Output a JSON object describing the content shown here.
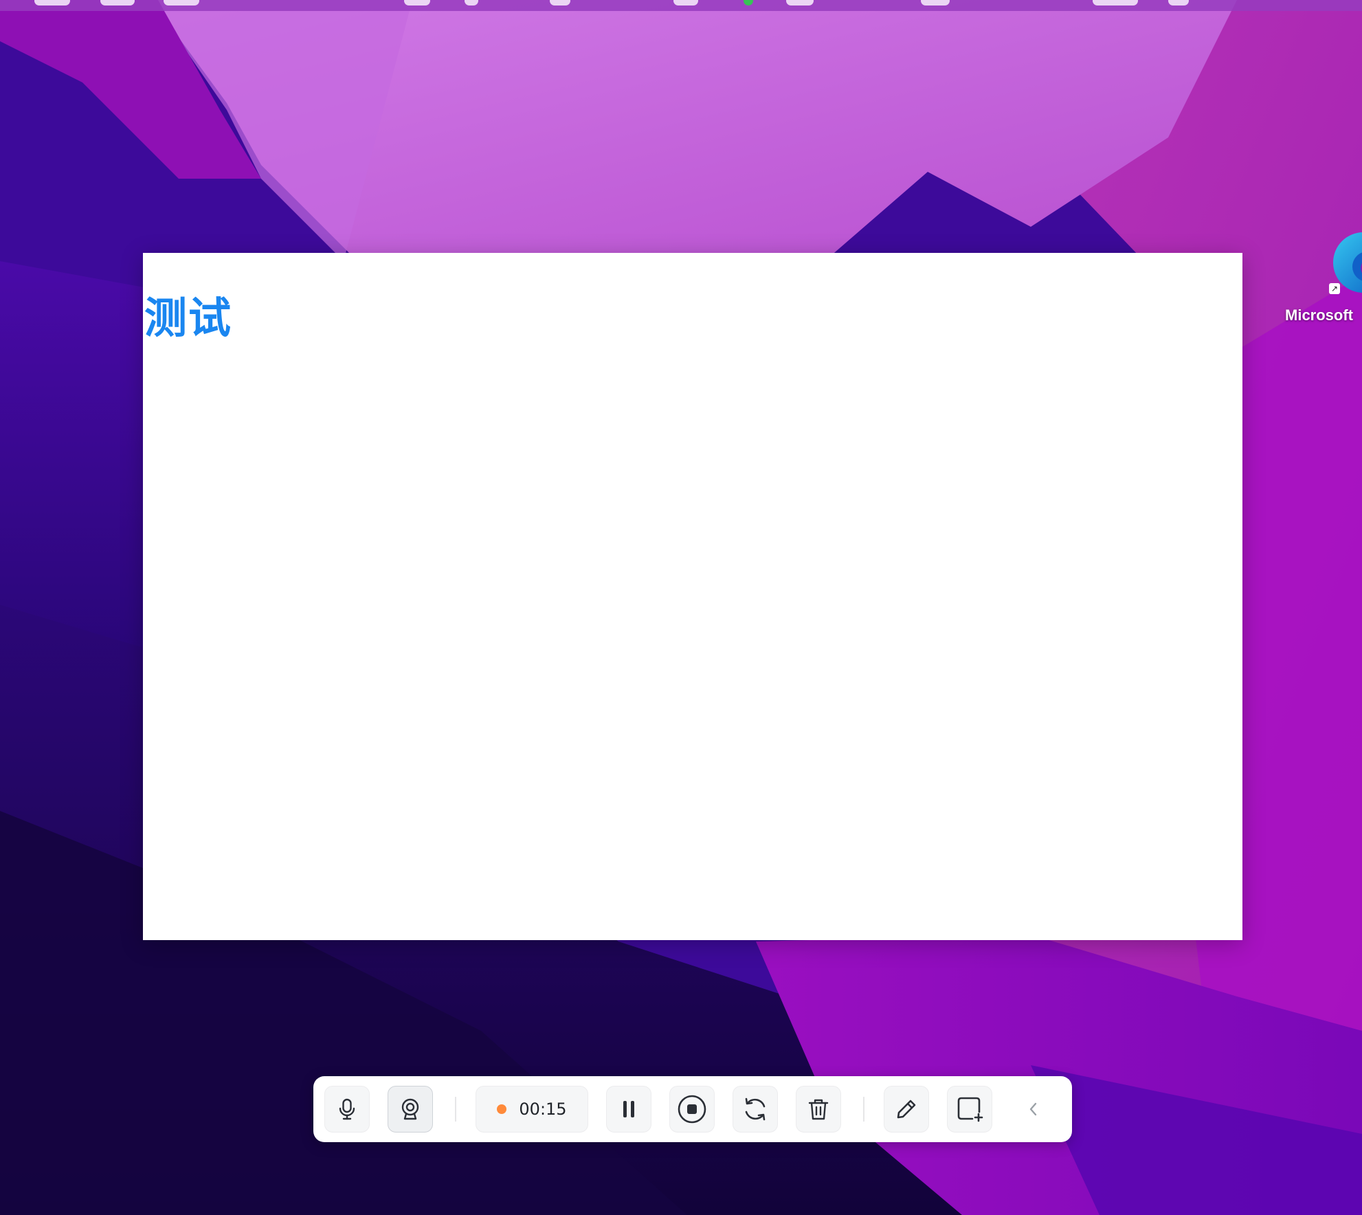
{
  "window": {
    "heading": "测试"
  },
  "desktop_icon": {
    "label": "Microsoft",
    "icon": "edge-browser-icon",
    "alias_glyph": "↗"
  },
  "toolbar": {
    "timer": "00:15",
    "recording_indicator_color": "#ff8a3a",
    "buttons": [
      {
        "name": "microphone",
        "icon": "microphone-icon"
      },
      {
        "name": "camera",
        "icon": "webcam-icon",
        "active": true
      },
      {
        "name": "pause",
        "icon": "pause-icon"
      },
      {
        "name": "stop",
        "icon": "stop-icon"
      },
      {
        "name": "restart",
        "icon": "restart-icon"
      },
      {
        "name": "delete",
        "icon": "trash-icon"
      },
      {
        "name": "annotate",
        "icon": "pencil-icon"
      },
      {
        "name": "add-area",
        "icon": "add-area-icon"
      },
      {
        "name": "collapse",
        "icon": "chevron-left-icon"
      }
    ]
  },
  "colors": {
    "heading": "#1a86f0",
    "toolbar_bg": "#ffffff",
    "icon_stroke": "#2b2f36"
  }
}
